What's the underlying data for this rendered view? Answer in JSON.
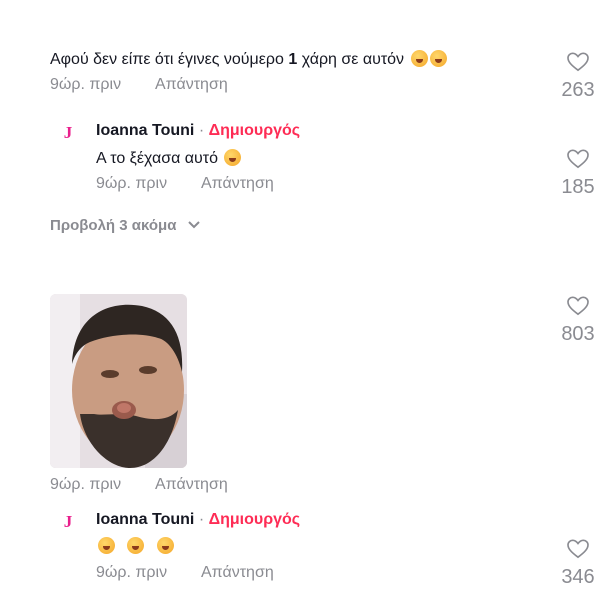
{
  "comments": [
    {
      "text": "Αφού δεν είπε ότι έγινες νούμερο",
      "text_bold": "1",
      "text_end": "χάρη σε αυτόν",
      "time": "9ώρ. πριν",
      "reply": "Απάντηση",
      "likes": "263"
    },
    {
      "author": "Ioanna Touni",
      "separator": "·",
      "creator_label": "Δημιουργός",
      "text": "Α το ξέχασα αυτό",
      "time": "9ώρ. πριν",
      "reply": "Απάντηση",
      "likes": "185"
    },
    {
      "time": "9ώρ. πριν",
      "reply": "Απάντηση",
      "likes": "803"
    },
    {
      "author": "Ioanna Touni",
      "separator": "·",
      "creator_label": "Δημιουργός",
      "time": "9ώρ. πριν",
      "reply": "Απάντηση",
      "likes": "346"
    }
  ],
  "view_more": "Προβολή 3 ακόμα",
  "avatar_letter": "J",
  "colors": {
    "creator": "#fe2c55",
    "meta": "#8a8b91",
    "avatar": "#e91e8c"
  }
}
